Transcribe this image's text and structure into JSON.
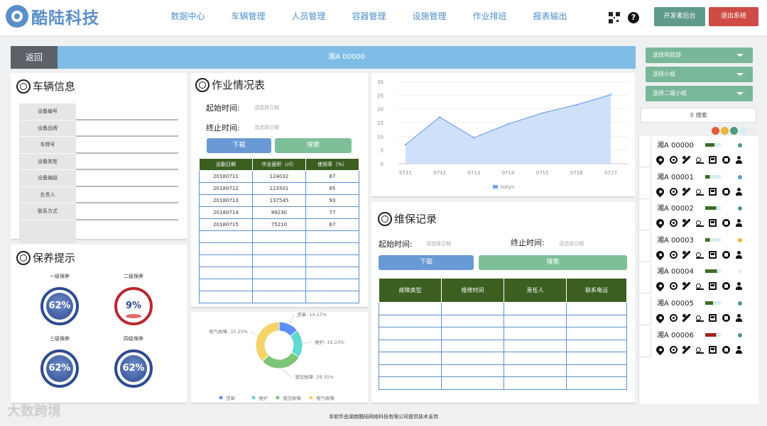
{
  "header": {
    "logo_text": "酷陆科技",
    "nav": [
      "数据中心",
      "车辆管理",
      "人员管理",
      "容器管理",
      "设施管理",
      "作业排班",
      "报表输出"
    ],
    "dev_button": "开发者后台",
    "exit_button": "退出系统",
    "help_glyph": "?"
  },
  "topbar": {
    "back_label": "返回",
    "plate": "湘A 00000"
  },
  "vehicle_info": {
    "title": "车辆信息",
    "fields": [
      "设备编号",
      "设备品牌",
      "车牌号",
      "设备类型",
      "设备编组",
      "负责人",
      "联系方式"
    ]
  },
  "reminder": {
    "title": "保养提示",
    "gauges": [
      {
        "label": "一级保养",
        "value": "62%"
      },
      {
        "label": "二级保养",
        "value": "9%"
      },
      {
        "label": "三级保养",
        "value": "62%"
      },
      {
        "label": "四级保养",
        "value": "62%"
      }
    ]
  },
  "work": {
    "title": "作业情况表",
    "start_label": "起始时间:",
    "end_label": "终止时间:",
    "date_placeholder": "请选择日期",
    "download_label": "下载",
    "search_label": "搜索",
    "columns": [
      "出勤日期",
      "作业面积（㎡）",
      "使用率（%）"
    ],
    "rows": [
      [
        "20180711",
        "124032",
        "87"
      ],
      [
        "20180712",
        "123501",
        "85"
      ],
      [
        "20180713",
        "137545",
        "93"
      ],
      [
        "20180714",
        "89230",
        "77"
      ],
      [
        "20180715",
        "75210",
        "67"
      ]
    ],
    "empty_rows": 6
  },
  "pie": {
    "slices": [
      {
        "name": "违章",
        "label": "违章: 14.17%",
        "value": 14.17,
        "color": "#5b8ff9"
      },
      {
        "name": "维护",
        "label": "维护: 19.23%",
        "value": 19.23,
        "color": "#61d9d0"
      },
      {
        "name": "液压故障",
        "label": "液压故障: 29.35%",
        "value": 29.35,
        "color": "#7cc576"
      },
      {
        "name": "电气故障",
        "label": "电气故障: 37.25%",
        "value": 37.25,
        "color": "#f3d469"
      }
    ]
  },
  "chart_data": {
    "type": "area",
    "categories": [
      "0711",
      "0712",
      "0713",
      "0714",
      "0715",
      "0716",
      "0717"
    ],
    "series": [
      {
        "name": "tokyo",
        "values": [
          7,
          17,
          9.5,
          14.5,
          18.5,
          21.5,
          25.2
        ]
      }
    ],
    "ylim": [
      0,
      30
    ],
    "yticks": [
      0,
      5,
      10,
      15,
      20,
      25,
      30
    ],
    "grid": true,
    "legend": "bottom",
    "color": "#6fa3f2"
  },
  "records": {
    "title": "维保记录",
    "start_label": "起始时间:",
    "end_label": "终止时间:",
    "date_placeholder": "请选择日期",
    "download_label": "下载",
    "search_label": "搜索",
    "columns": [
      "故障类型",
      "维修时间",
      "责任人",
      "联系电话"
    ],
    "empty_rows": 7
  },
  "sidebar": {
    "selects": [
      "选择项目部",
      "选择小组",
      "选择二级小组"
    ],
    "search_label": "搜索",
    "legend_colors": [
      "#e4573a",
      "#f0b43a",
      "#4c9a80",
      "#d9ecf0",
      "#eeeeee"
    ],
    "vehicles": [
      {
        "name": "湘A 00000",
        "bar": "#3d6e25",
        "bar_fill": 0.6,
        "dot": "#4c9a80"
      },
      {
        "name": "湘A 00001",
        "bar": "#3d6e25",
        "bar_fill": 0.3,
        "dot": "#5b9ad8"
      },
      {
        "name": "湘A 00002",
        "bar": "#3d6e25",
        "bar_fill": 0.7,
        "dot": "#4c9a80"
      },
      {
        "name": "湘A 00003",
        "bar": "#3d6e25",
        "bar_fill": 0.3,
        "dot": "#f0b43a"
      },
      {
        "name": "湘A 00004",
        "bar": "#3d6e25",
        "bar_fill": 0.75,
        "dot": "#eeeeee"
      },
      {
        "name": "湘A 00005",
        "bar": "#3d6e25",
        "bar_fill": 0.5,
        "dot": "#4c9a80"
      },
      {
        "name": "湘A 00006",
        "bar": "#a02020",
        "bar_fill": 0.7,
        "dot": "#4c9a80"
      }
    ]
  },
  "footer": {
    "text": "本软件由湖南酷陆网络科技有限公司提供技术支持",
    "watermark": "大数跨境"
  }
}
